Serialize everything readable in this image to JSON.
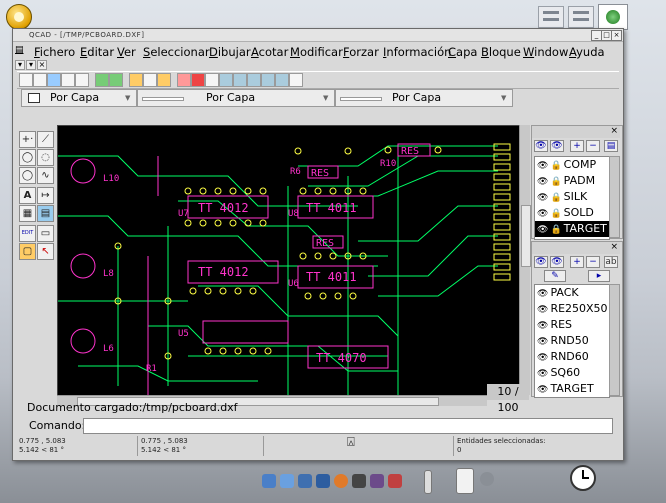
{
  "window": {
    "title": "QCAD - [/TMP/PCBOARD.DXF]",
    "controls": [
      "_",
      "□",
      "×"
    ]
  },
  "menu": [
    "Fichero",
    "Editar",
    "Ver",
    "Seleccionar",
    "Dibujar",
    "Acotar",
    "Modificar",
    "Forzar",
    "Información",
    "Capa",
    "Bloque",
    "Window",
    "Ayuda"
  ],
  "mdi_controls": [
    "▾",
    "▾",
    "×"
  ],
  "penbar": {
    "color": "Por Capa",
    "width": "Por Capa",
    "linetype": "Por Capa"
  },
  "tools": [
    "+·",
    "⟋",
    "◯",
    "◌",
    "◯",
    "∿",
    "A",
    "↦",
    "▦",
    "▤",
    "EDIT",
    "▭",
    "▢",
    "↖"
  ],
  "layers_panel": {
    "close": "×",
    "buttons": [
      "👁",
      "👁",
      "+",
      "−",
      "▤"
    ],
    "items": [
      {
        "name": "COMP",
        "selected": false
      },
      {
        "name": "PADM",
        "selected": false
      },
      {
        "name": "SILK",
        "selected": false
      },
      {
        "name": "SOLD",
        "selected": false
      },
      {
        "name": "TARGET",
        "selected": true
      }
    ]
  },
  "blocks_panel": {
    "close": "×",
    "buttons": [
      "👁",
      "👁",
      "+",
      "−",
      "ab"
    ],
    "buttons2": [
      "✎",
      "▸"
    ],
    "items": [
      "PACK",
      "RE250X50",
      "RES",
      "RND50",
      "RND60",
      "SQ60",
      "TARGET"
    ]
  },
  "canvas": {
    "grid_label": "10 / 100",
    "colors": {
      "background": "#000000",
      "tracks": "#00ff66",
      "silk": "#ff33cc",
      "pads": "#ffff44",
      "copper": "#ff4444"
    },
    "texts": [
      "RES",
      "RES",
      "RES",
      "TT 4012",
      "TT 4012",
      "TT 4011",
      "TT 4011",
      "TT 4070",
      "R10",
      "R6",
      "L10",
      "L8",
      "L6",
      "U7",
      "U5",
      "U6",
      "U8",
      "R1"
    ]
  },
  "status_message": "Documento cargado:/tmp/pcboard.dxf",
  "command": {
    "label": "Comando:",
    "value": ""
  },
  "coords": {
    "abs1": "0.775 , 5.083",
    "rel1": "5.142 < 81 °",
    "abs2": "0.775 , 5.083",
    "rel2": "5.142 < 81 °",
    "selection_label": "Entidades seleccionadas:",
    "selection_count": "0"
  },
  "taskbar": {
    "clock": "clock-icon"
  }
}
